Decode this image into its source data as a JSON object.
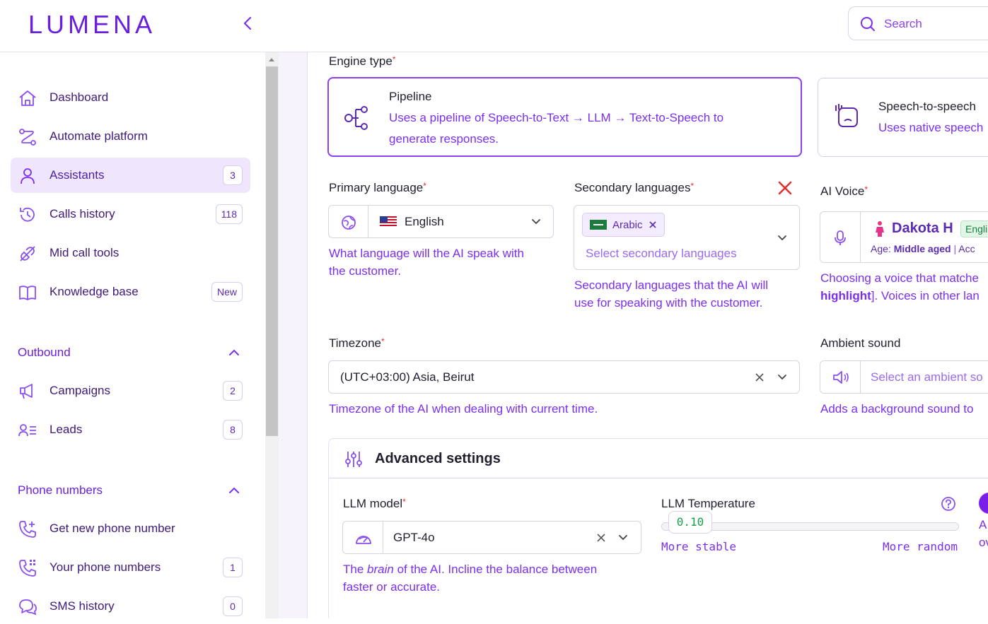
{
  "brand": {
    "logo": "LUMENA",
    "accent": "#6a1fe0"
  },
  "header": {
    "search_placeholder": "Search"
  },
  "sidebar": {
    "items": [
      {
        "label": "Dashboard",
        "icon": "home-icon"
      },
      {
        "label": "Automate platform",
        "icon": "workflow-icon"
      },
      {
        "label": "Assistants",
        "icon": "user-icon",
        "badge": "3",
        "active": true
      },
      {
        "label": "Calls history",
        "icon": "history-icon",
        "badge": "118"
      },
      {
        "label": "Mid call tools",
        "icon": "plug-icon"
      },
      {
        "label": "Knowledge base",
        "icon": "book-icon",
        "badge": "New"
      }
    ],
    "outbound": {
      "title": "Outbound",
      "items": [
        {
          "label": "Campaigns",
          "icon": "megaphone-icon",
          "badge": "2"
        },
        {
          "label": "Leads",
          "icon": "leads-icon",
          "badge": "8"
        }
      ]
    },
    "phone_numbers": {
      "title": "Phone numbers",
      "items": [
        {
          "label": "Get new phone number",
          "icon": "phone-plus-icon"
        },
        {
          "label": "Your phone numbers",
          "icon": "phone-grid-icon",
          "badge": "1"
        },
        {
          "label": "SMS history",
          "icon": "chat-icon",
          "badge": "0"
        }
      ]
    }
  },
  "engine": {
    "label": "Engine type",
    "req": "*",
    "pipeline": {
      "title": "Pipeline",
      "desc1": "Uses a pipeline of Speech-to-Text → LLM → Text-to-Speech to",
      "desc2": "generate responses."
    },
    "s2s": {
      "title": "Speech-to-speech",
      "desc": "Uses native speech"
    }
  },
  "primary_language": {
    "label": "Primary language",
    "req": "*",
    "value": "English",
    "help1": "What language will the AI speak with",
    "help2": "the customer."
  },
  "secondary_languages": {
    "label": "Secondary languages",
    "req": "*",
    "chip": "Arabic",
    "placeholder": "Select secondary languages",
    "help1": "Secondary languages that the AI will",
    "help2": "use for speaking with the customer."
  },
  "ai_voice": {
    "label": "AI Voice",
    "req": "*",
    "name": "Dakota H",
    "lang_tag": "Engli",
    "age_label": "Age:",
    "age_value": "Middle aged",
    "accent_label": "Acc",
    "help1": "Choosing a voice that matche",
    "help2_bold": "highlight",
    "help2_rest": "]. Voices in other lan"
  },
  "timezone": {
    "label": "Timezone",
    "req": "*",
    "value": "(UTC+03:00) Asia, Beirut",
    "help": "Timezone of the AI when dealing with current time."
  },
  "ambient": {
    "label": "Ambient sound",
    "placeholder": "Select an ambient so",
    "help": "Adds a background sound to"
  },
  "advanced": {
    "title": "Advanced settings",
    "llm_model": {
      "label": "LLM model",
      "req": "*",
      "value": "GPT-4o",
      "help_pre": "The ",
      "help_em": "brain",
      "help_post": " of the AI. Incline the balance between",
      "help2": "faster or accurate."
    },
    "temperature": {
      "label": "LLM Temperature",
      "value": "0.10",
      "fraction": 0.1,
      "min_label": "More stable",
      "max_label": "More random"
    },
    "right_cut": {
      "a": "A",
      "b": "ov"
    }
  }
}
